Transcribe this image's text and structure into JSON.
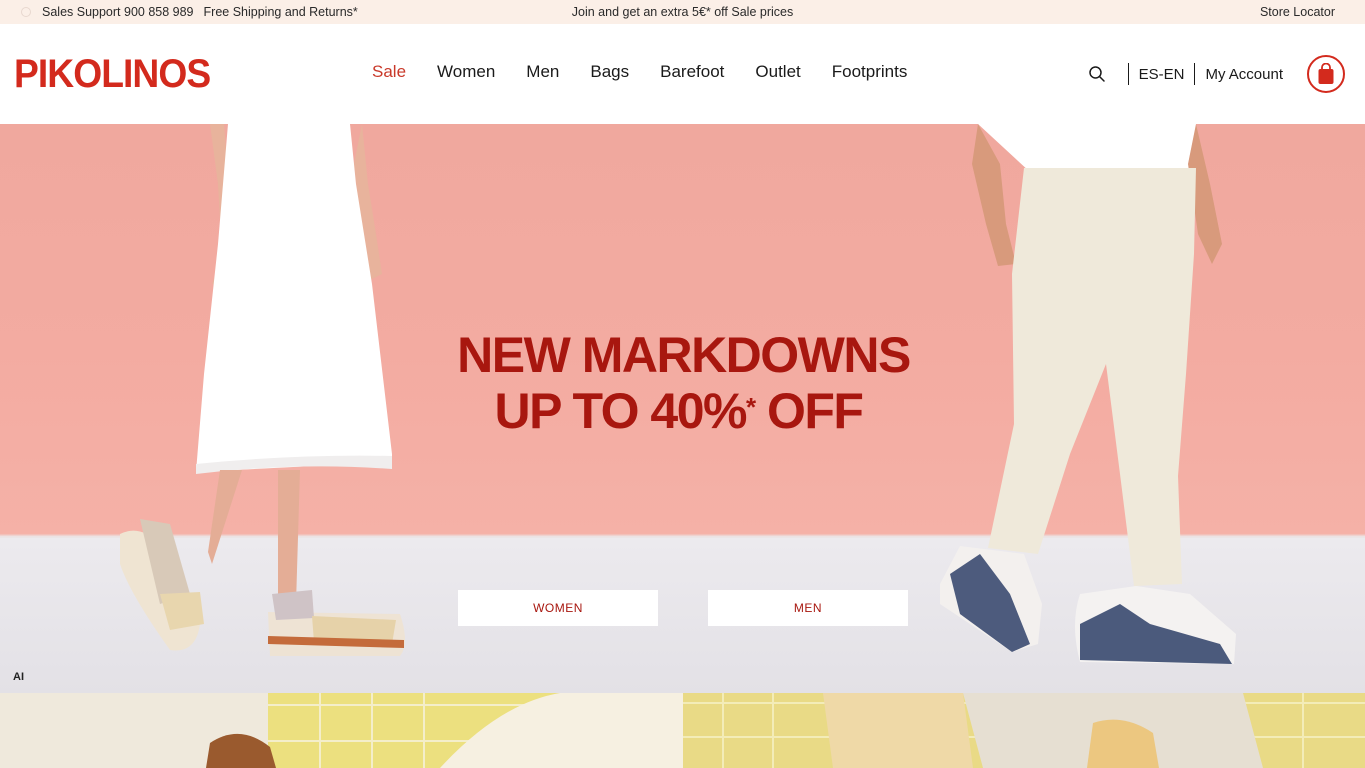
{
  "topbar": {
    "sales_support": "Sales Support 900 858 989",
    "free_shipping": "Free Shipping and Returns*",
    "promo": "Join and get an extra 5€* off Sale prices",
    "store_locator": "Store Locator"
  },
  "header": {
    "logo": "PIKOLINOS",
    "nav": [
      "Sale",
      "Women",
      "Men",
      "Bags",
      "Barefoot",
      "Outlet",
      "Footprints"
    ],
    "language": "ES-EN",
    "account": "My Account"
  },
  "hero": {
    "headline_line1": "NEW MARKDOWNS",
    "headline_line2": "UP TO  40%",
    "headline_asterisk": "*",
    "headline_off": " OFF",
    "button_women": "WOMEN",
    "button_men": "MEN",
    "ai_badge": "AI"
  },
  "colors": {
    "brand_red": "#d32a1d",
    "headline_red": "#a8170f",
    "topbar_bg": "#fbefe7",
    "hero_pink": "#f3aba1"
  }
}
